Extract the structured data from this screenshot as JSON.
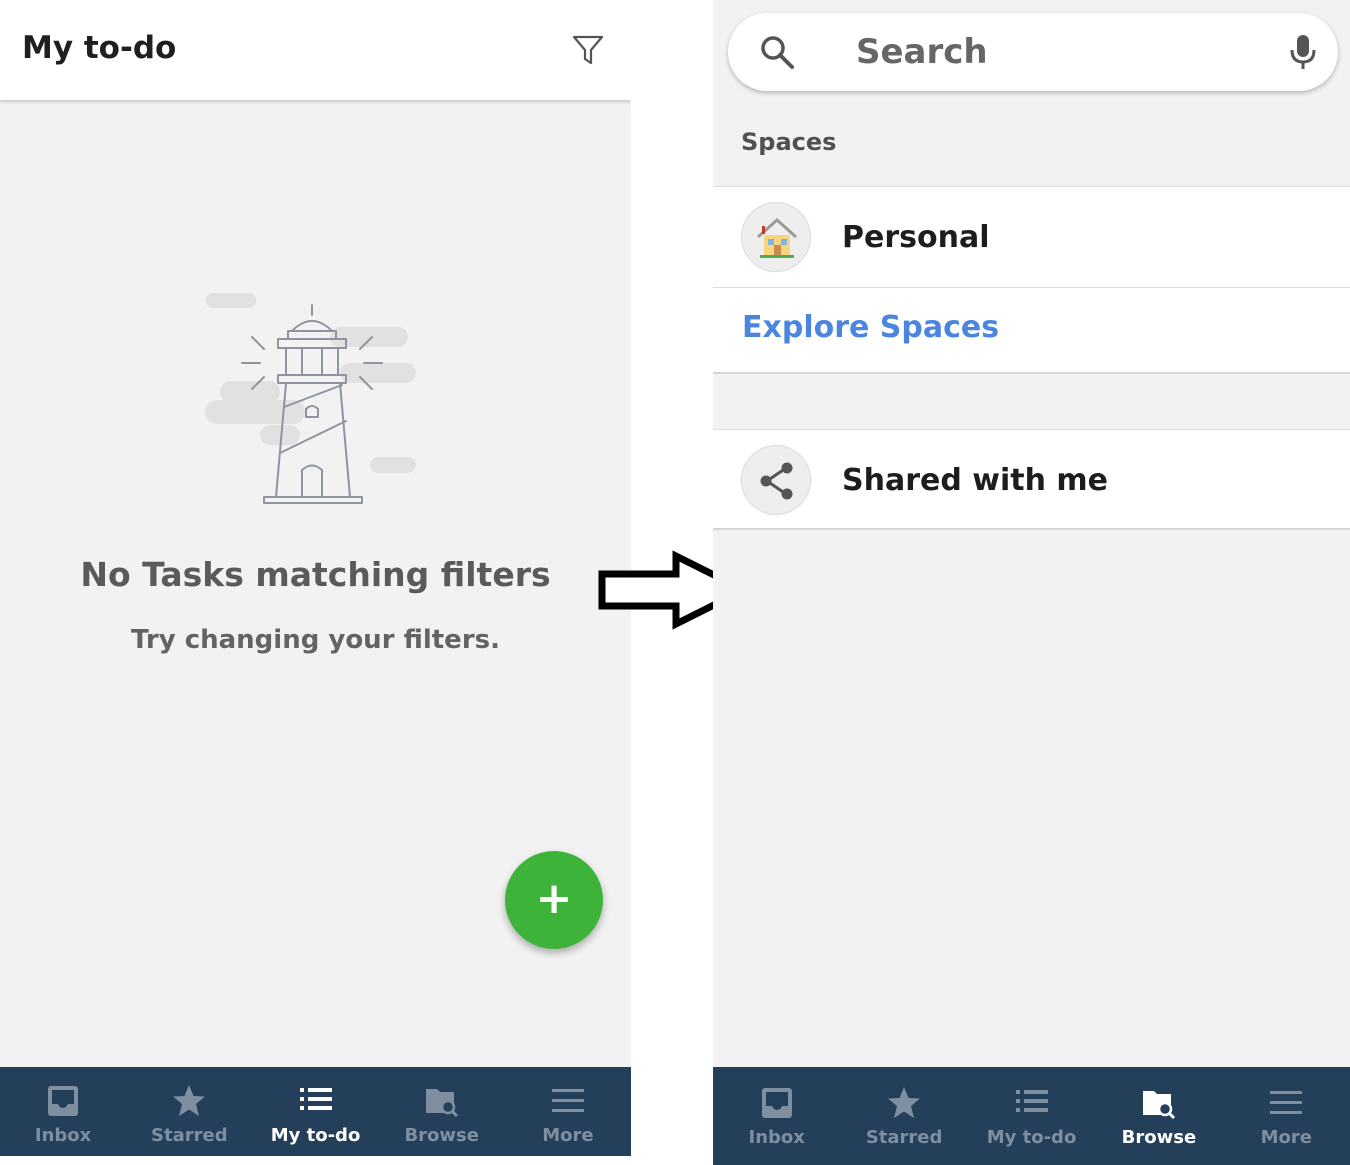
{
  "left_screen": {
    "header": {
      "title": "My to-do",
      "filter_icon": "filter-icon"
    },
    "empty_state": {
      "illustration": "lighthouse-illustration",
      "title": "No Tasks matching filters",
      "subtitle": "Try changing your filters."
    },
    "fab": {
      "label": "+",
      "color": "#3eb33a"
    },
    "bottom_nav": {
      "items": [
        {
          "label": "Inbox",
          "icon": "inbox-icon"
        },
        {
          "label": "Starred",
          "icon": "star-icon"
        },
        {
          "label": "My to-do",
          "icon": "list-icon",
          "active": true
        },
        {
          "label": "Browse",
          "icon": "browse-icon"
        },
        {
          "label": "More",
          "icon": "menu-icon"
        }
      ]
    }
  },
  "arrow": {
    "icon": "right-arrow-icon"
  },
  "right_screen": {
    "search": {
      "placeholder": "Search",
      "icon": "search-icon",
      "mic_icon": "mic-icon"
    },
    "spaces_header": "Spaces",
    "spaces": [
      {
        "label": "Personal",
        "icon": "house-icon"
      }
    ],
    "explore_link": "Explore Spaces",
    "shared": {
      "label": "Shared with me",
      "icon": "share-icon"
    },
    "bottom_nav": {
      "items": [
        {
          "label": "Inbox",
          "icon": "inbox-icon"
        },
        {
          "label": "Starred",
          "icon": "star-icon"
        },
        {
          "label": "My to-do",
          "icon": "list-icon"
        },
        {
          "label": "Browse",
          "icon": "browse-icon",
          "active": true
        },
        {
          "label": "More",
          "icon": "menu-icon"
        }
      ]
    }
  },
  "colors": {
    "nav_bg": "#243f5a",
    "accent_link": "#4a86e0",
    "fab_green": "#3eb33a",
    "screen_bg": "#f2f2f2"
  }
}
